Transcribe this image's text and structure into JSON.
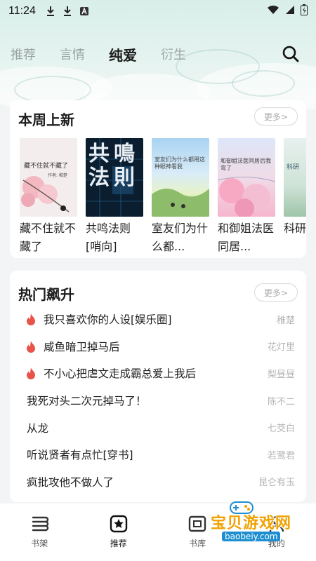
{
  "status_bar": {
    "time": "11:24"
  },
  "top_tabs": [
    {
      "label": "推荐",
      "active": false
    },
    {
      "label": "言情",
      "active": false
    },
    {
      "label": "纯爱",
      "active": true
    },
    {
      "label": "衍生",
      "active": false
    }
  ],
  "new_this_week": {
    "title": "本周上新",
    "more_label": "更多>",
    "books": [
      {
        "title": "藏不住就不藏了",
        "cover_text": "藏不住就不藏了",
        "cover_author": "作者: 稚楚"
      },
      {
        "title": "共鸣法则[哨向]",
        "cover_text": "共鳴法則"
      },
      {
        "title": "室友们为什么都...",
        "cover_text": "室友们为什么都用这种眼神看我"
      },
      {
        "title": "和御姐法医同居...",
        "cover_text": "和御姐法医同居后我弯了"
      },
      {
        "title": "科研和影...",
        "cover_text": "科研"
      }
    ]
  },
  "hot_rising": {
    "title": "热门飙升",
    "more_label": "更多>",
    "items": [
      {
        "title": "我只喜欢你的人设[娱乐圈]",
        "author": "稚楚",
        "hot": true
      },
      {
        "title": "咸鱼暗卫掉马后",
        "author": "花灯里",
        "hot": true
      },
      {
        "title": "不小心把虐文走成霸总爱上我后",
        "author": "梨昼昼",
        "hot": true
      },
      {
        "title": "我死对头二次元掉马了！",
        "author": "陈不二",
        "hot": false
      },
      {
        "title": "从龙",
        "author": "七茭白",
        "hot": false
      },
      {
        "title": "听说贤者有点忙[穿书]",
        "author": "若鹭君",
        "hot": false
      },
      {
        "title": "疯批攻他不做人了",
        "author": "昆仑有玉",
        "hot": false
      }
    ]
  },
  "bottom_nav": [
    {
      "label": "书架",
      "icon": "bookshelf-icon",
      "active": false
    },
    {
      "label": "推荐",
      "icon": "star-icon",
      "active": true
    },
    {
      "label": "书库",
      "icon": "library-icon",
      "active": false
    },
    {
      "label": "我的",
      "icon": "profile-icon",
      "active": false
    }
  ],
  "watermark": {
    "text": "宝贝游戏网",
    "url": "baobeiy.com"
  },
  "colors": {
    "accent_flame": "#e8534a",
    "header_bg": "#dbeee9",
    "page_bg": "#f3f4f5"
  }
}
